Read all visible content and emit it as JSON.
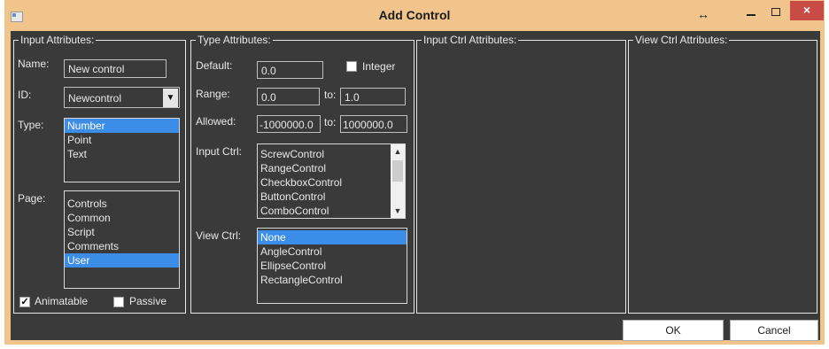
{
  "window": {
    "title": "Add Control",
    "resize_glyph": "↔",
    "close_glyph": "×"
  },
  "input_attributes": {
    "legend": "Input Attributes:",
    "name_label": "Name:",
    "name_value": "New control",
    "id_label": "ID:",
    "id_value": "Newcontrol",
    "type_label": "Type:",
    "type_options": [
      {
        "label": "Number",
        "selected": true
      },
      {
        "label": "Point",
        "selected": false
      },
      {
        "label": "Text",
        "selected": false
      }
    ],
    "page_label": "Page:",
    "page_options": [
      {
        "label": "Controls",
        "selected": false
      },
      {
        "label": "Common",
        "selected": false
      },
      {
        "label": "Script",
        "selected": false
      },
      {
        "label": "Comments",
        "selected": false
      },
      {
        "label": "User",
        "selected": true
      }
    ],
    "animatable_label": "Animatable",
    "animatable_checked": true,
    "passive_label": "Passive",
    "passive_checked": false
  },
  "type_attributes": {
    "legend": "Type Attributes:",
    "default_label": "Default:",
    "default_value": "0.0",
    "integer_label": "Integer",
    "integer_checked": false,
    "range_label": "Range:",
    "range_min": "0.0",
    "range_to_label": "to:",
    "range_max": "1.0",
    "allowed_label": "Allowed:",
    "allowed_min": "-1000000.0",
    "allowed_to_label": "to:",
    "allowed_max": "1000000.0",
    "input_ctrl_label": "Input Ctrl:",
    "input_ctrl_options": [
      {
        "label": "ScrewControl",
        "selected": false
      },
      {
        "label": "RangeControl",
        "selected": false
      },
      {
        "label": "CheckboxControl",
        "selected": false
      },
      {
        "label": "ButtonControl",
        "selected": false
      },
      {
        "label": "ComboControl",
        "selected": false
      }
    ],
    "view_ctrl_label": "View Ctrl:",
    "view_ctrl_options": [
      {
        "label": "None",
        "selected": true
      },
      {
        "label": "AngleControl",
        "selected": false
      },
      {
        "label": "EllipseControl",
        "selected": false
      },
      {
        "label": "RectangleControl",
        "selected": false
      }
    ]
  },
  "input_ctrl_attributes": {
    "legend": "Input Ctrl Attributes:"
  },
  "view_ctrl_attributes": {
    "legend": "View Ctrl Attributes:"
  },
  "buttons": {
    "ok": "OK",
    "cancel": "Cancel"
  },
  "colors": {
    "title_bar": "#f0c48a",
    "client": "#3a3a3a",
    "selection": "#3c8de8",
    "close": "#c84b45"
  },
  "icons": [
    "app-icon",
    "resize-icon",
    "minimize-icon",
    "maximize-icon",
    "close-icon",
    "dropdown-arrow-icon",
    "scroll-up-icon",
    "scroll-down-icon",
    "checkmark-icon"
  ]
}
